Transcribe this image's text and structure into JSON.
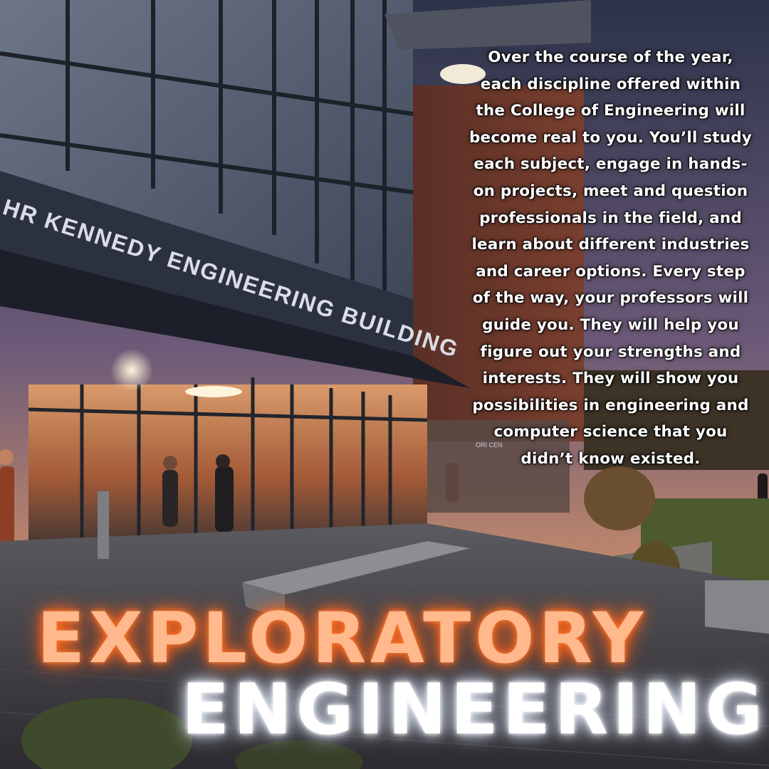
{
  "photo": {
    "building_sign": "HR KENNEDY ENGINEERING BUILDING",
    "door_sign": "ORI CEN"
  },
  "body_text": "Over the course of the year, each discipline offered within the College of Engineering will become real to you. You’ll study each subject, engage in hands-on projects, meet and question professionals in the field, and learn about different industries and career options. Every step of the way, your professors will guide you. They will help you figure out your strengths and interests. They will show you possibilities in engineering and computer science that you didn’t know existed.",
  "headline": {
    "line1": "EXPLORATORY",
    "line2": "ENGINEERING"
  },
  "colors": {
    "accent_orange": "#ff8a4c",
    "glow_white": "#ffffff"
  }
}
